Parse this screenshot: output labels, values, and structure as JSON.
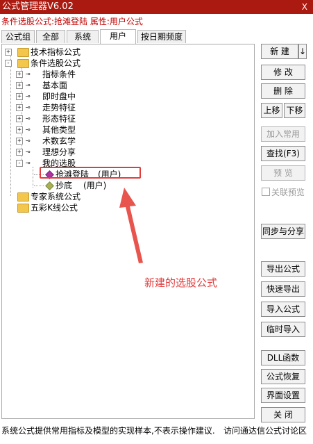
{
  "window": {
    "title": "公式管理器V6.02",
    "close": "X"
  },
  "info": {
    "label": "条件选股公式:抢滩登陆 属性:用户公式"
  },
  "tabs": [
    "公式组",
    "全部",
    "系统",
    "用户",
    "按日期频度"
  ],
  "tree": {
    "root1": "技术指标公式",
    "root2": "条件选股公式",
    "children": [
      "指标条件",
      "基本面",
      "即时盘中",
      "走势特征",
      "形态特征",
      "其他类型",
      "术数玄学",
      "理想分享",
      "我的选股"
    ],
    "mine": [
      {
        "name": "抢滩登陆",
        "tag": "(用户)"
      },
      {
        "name": "抄底",
        "tag": "(用户)"
      }
    ],
    "root3": "专家系统公式",
    "root4": "五彩K线公式"
  },
  "annotation": "新建的选股公式",
  "buttons": {
    "new": "新 建",
    "new_arrow": "↓",
    "edit": "修 改",
    "delete": "删 除",
    "up": "上移",
    "down": "下移",
    "add_common": "加入常用",
    "find": "查找(F3)",
    "preview": "预 览",
    "linked_preview": "关联预览",
    "sync_share": "同步与分享",
    "export": "导出公式",
    "quick_export": "快速导出",
    "import": "导入公式",
    "temp_import": "临时导入",
    "dll": "DLL函数",
    "restore": "公式恢复",
    "ui_settings": "界面设置",
    "close": "关 闭"
  },
  "status": {
    "left": "系统公式提供常用指标及模型的实现样本,不表示操作建议.",
    "right": "访问通达信公式讨论区"
  },
  "colors": {
    "title_bg": "#ab1a10",
    "highlight": "#e53a3a",
    "info_text": "#c00000"
  }
}
